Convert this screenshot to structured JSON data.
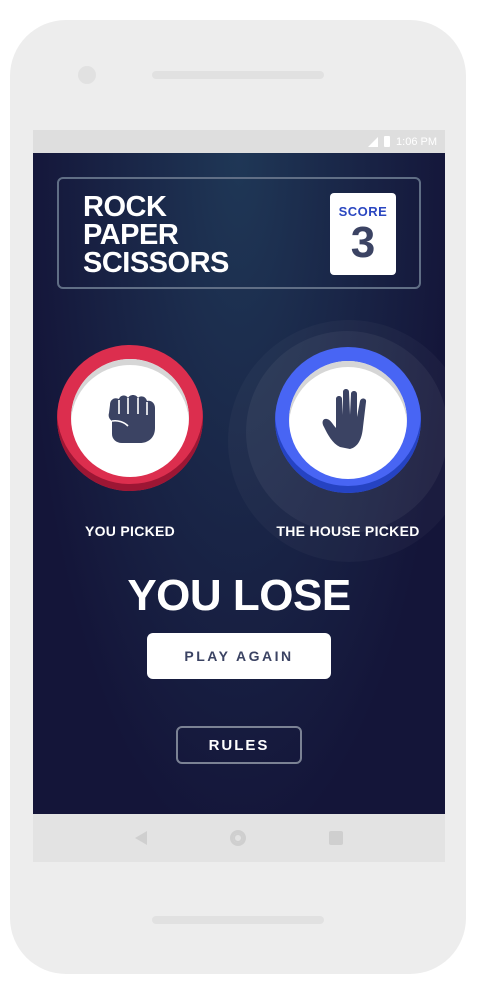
{
  "status_bar": {
    "time": "1:06 PM",
    "signal_icon": "signal-icon",
    "battery_icon": "battery-icon"
  },
  "game": {
    "title_lines": [
      "ROCK",
      "PAPER",
      "SCISSORS"
    ],
    "score": {
      "label": "SCORE",
      "value": "3"
    },
    "player": {
      "label": "YOU PICKED",
      "choice_icon": "rock-fist-icon",
      "color": "#dc2e4e"
    },
    "house": {
      "label": "THE HOUSE PICKED",
      "choice_icon": "paper-hand-icon",
      "color": "#4865f4"
    },
    "result": "YOU LOSE",
    "play_again_label": "PLAY AGAIN",
    "rules_label": "RULES"
  },
  "nav_bar": {
    "back_icon": "back-icon",
    "home_icon": "home-icon",
    "recent_icon": "recent-apps-icon"
  },
  "colors": {
    "background": "#141539",
    "header_outline": "#606e85",
    "score_text": "#2a46c0",
    "dark_text": "#3b4363"
  }
}
